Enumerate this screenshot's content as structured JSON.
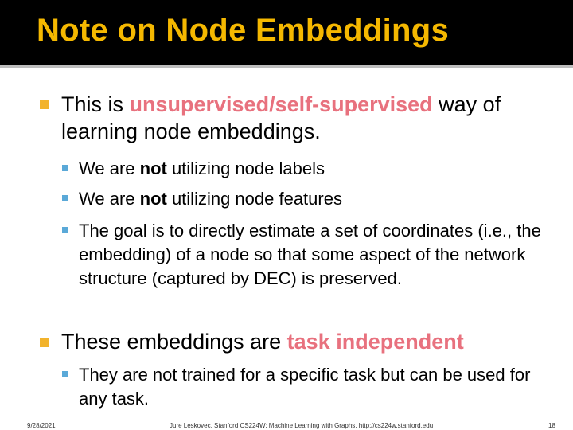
{
  "slide": {
    "title": "Note on Node Embeddings",
    "bullets": {
      "b1": {
        "pre": "This is ",
        "highlight": "unsupervised/self-supervised",
        "post": " way of learning node embeddings."
      },
      "b1_1": {
        "pre": "We are ",
        "bold": "not",
        "post": " utilizing node labels"
      },
      "b1_2": {
        "pre": "We are ",
        "bold": "not",
        "post": " utilizing node features"
      },
      "b1_3": "The goal is to directly estimate a set of coordinates (i.e., the embedding) of a node so that some aspect of the network structure (captured by DEC) is preserved.",
      "b2": {
        "pre": "These embeddings are ",
        "highlight": "task independent"
      },
      "b2_1": "They are not trained for a specific task but can be used for any task."
    },
    "footer": {
      "date": "9/28/2021",
      "credit": "Jure Leskovec, Stanford CS224W: Machine Learning with Graphs, http://cs224w.stanford.edu",
      "page": "18"
    },
    "colors": {
      "title": "#f5b800",
      "highlight": "#e8717e",
      "bullet_level1": "#f2b32c",
      "bullet_level2": "#5aa9d8"
    }
  }
}
